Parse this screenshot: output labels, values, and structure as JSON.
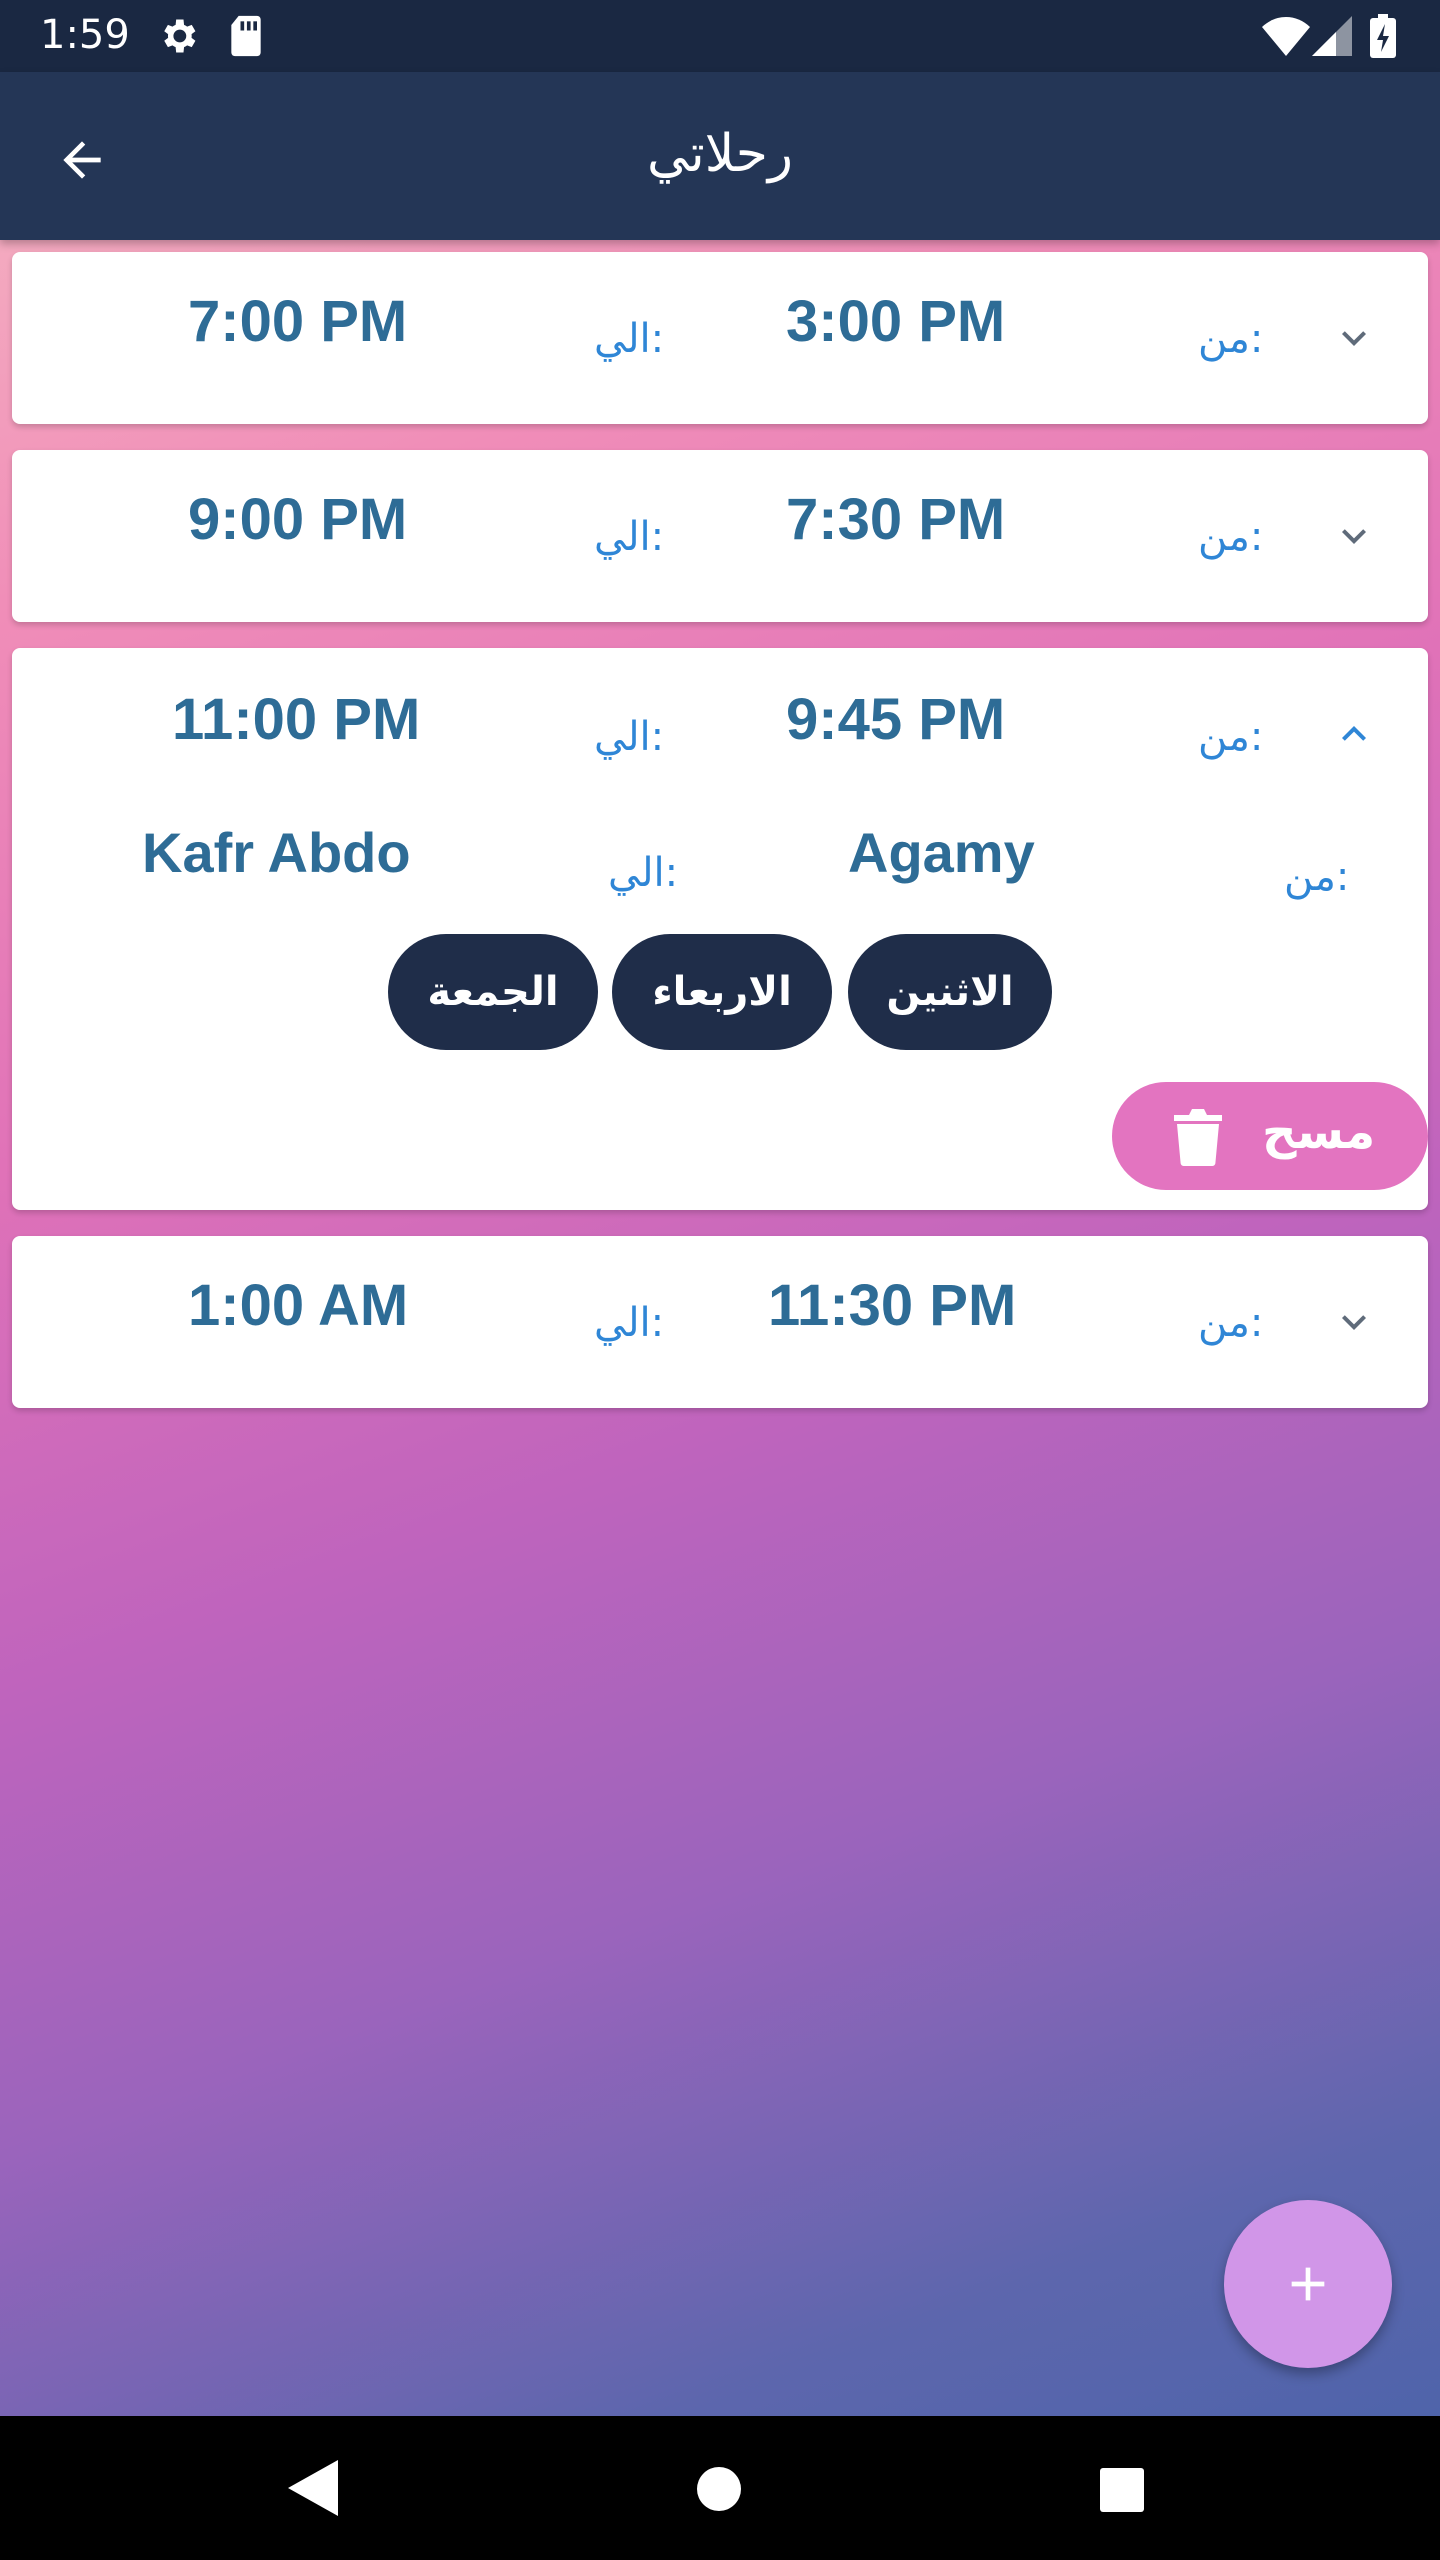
{
  "status_bar": {
    "time": "1:59",
    "icons": [
      "gear-icon",
      "sd-card-icon",
      "wifi-icon",
      "signal-icon",
      "battery-charging-icon"
    ]
  },
  "app_bar": {
    "title": "رحلاتي",
    "back_icon": "arrow-back-icon"
  },
  "labels": {
    "from": "من:",
    "to": "الي:"
  },
  "trips": [
    {
      "from_time": "3:00 PM",
      "to_time": "7:00 PM",
      "expanded": false
    },
    {
      "from_time": "7:30 PM",
      "to_time": "9:00 PM",
      "expanded": false
    },
    {
      "from_time": "9:45 PM",
      "to_time": "11:00 PM",
      "expanded": true,
      "from_place": "Agamy",
      "to_place": "Kafr Abdo",
      "days": [
        "الاثنين",
        "الاربعاء",
        "الجمعة"
      ],
      "delete_label": "مسح"
    },
    {
      "from_time": "11:30 PM",
      "to_time": "1:00 AM",
      "expanded": false
    }
  ],
  "fab": {
    "icon": "plus-icon"
  },
  "nav_bar": {
    "icons": [
      "nav-back-icon",
      "nav-home-icon",
      "nav-recents-icon"
    ]
  },
  "colors": {
    "app_bar": "#243656",
    "status_bar": "#1a2842",
    "time_text": "#2e6c96",
    "label_text": "#2f86d6",
    "chip_bg": "#1f2d49",
    "delete_bg": "#e374c0",
    "fab_bg": "#d196e8"
  }
}
